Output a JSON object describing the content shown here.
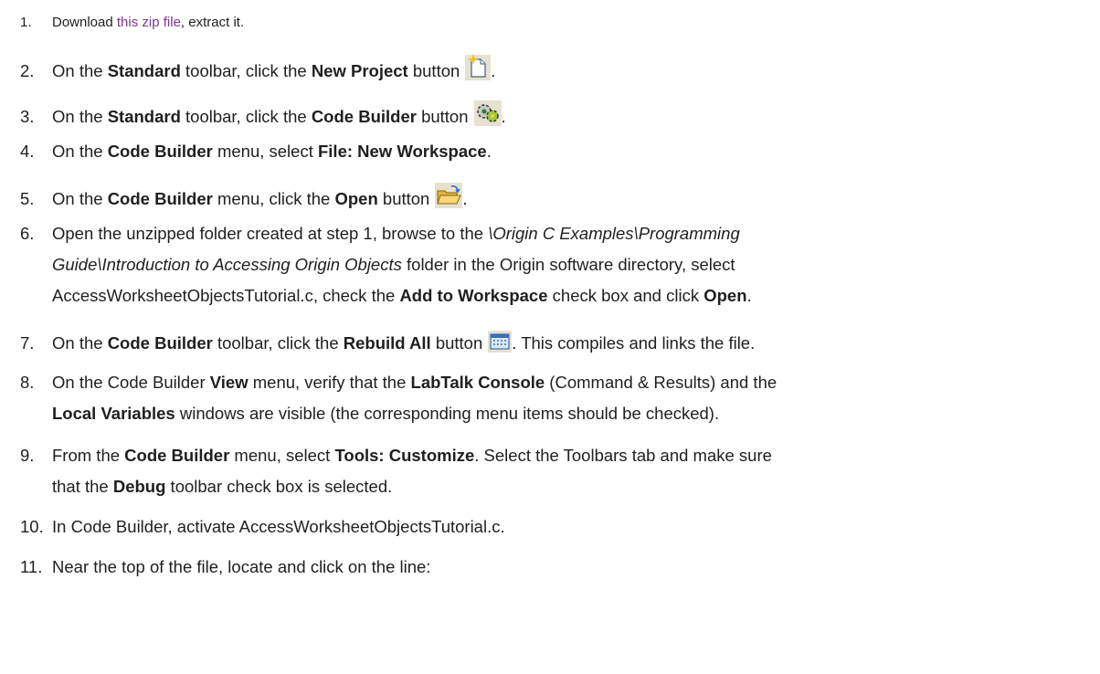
{
  "steps": [
    {
      "num": "1.",
      "text_a": "Download ",
      "link": "this zip file",
      "text_b": ", extract it."
    },
    {
      "num": "2.",
      "a": "On the ",
      "b": "Standard",
      "c": " toolbar, click the ",
      "d": "New Project",
      "e": " button",
      "f": "."
    },
    {
      "num": "3.",
      "a": "On the ",
      "b": "Standard",
      "c": " toolbar, click the ",
      "d": "Code Builder",
      "e": " button",
      "f": "."
    },
    {
      "num": "4.",
      "a": "On the ",
      "b": "Code Builder",
      "c": " menu, select ",
      "d": "File: New Workspace",
      "e": "."
    },
    {
      "num": "5.",
      "a": "On the ",
      "b": "Code Builder",
      "c": " menu, click the ",
      "d": "Open",
      "e": " button",
      "f": "."
    },
    {
      "num": "6.",
      "l1a": "Open the unzipped folder created at step 1, browse to the ",
      "l1b": "\\Origin C Examples\\Programming",
      "l2a": "Guide\\Introduction to Accessing Origin Objects",
      "l2b": " folder in the Origin software directory, select",
      "l3a": "AccessWorksheetObjectsTutorial.c, check the ",
      "l3b": "Add to Workspace",
      "l3c": " check box and click ",
      "l3d": "Open",
      "l3e": "."
    },
    {
      "num": "7.",
      "a": "On the ",
      "b": "Code Builder",
      "c": " toolbar, click the ",
      "d": "Rebuild All",
      "e": " button",
      "f": ". This compiles and links the file."
    },
    {
      "num": "8.",
      "l1a": "On the Code Builder ",
      "l1b": "View",
      "l1c": " menu, verify that the ",
      "l1d": "LabTalk Console",
      "l1e": " (Command & Results) and the",
      "l2a": "Local Variables",
      "l2b": " windows are visible (the corresponding menu items should be checked)."
    },
    {
      "num": "9.",
      "l1a": "From the ",
      "l1b": "Code Builder",
      "l1c": " menu, select ",
      "l1d": "Tools: Customize",
      "l1e": ". Select the Toolbars tab and make sure",
      "l2a": "that the ",
      "l2b": "Debug",
      "l2c": " toolbar check box is selected."
    },
    {
      "num": "10.",
      "a": "In Code Builder, activate AccessWorksheetObjectsTutorial.c."
    },
    {
      "num": "11.",
      "a": "Near the top of the file, locate and click on the line:"
    }
  ],
  "icons": [
    "new-project-icon",
    "code-builder-icon",
    "open-folder-icon",
    "rebuild-all-icon"
  ],
  "colors": {
    "link": "#7b3a8a",
    "text": "#1f1f1f"
  }
}
